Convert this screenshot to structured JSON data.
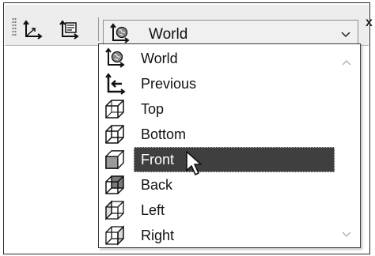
{
  "toolbar": {
    "combo": {
      "selected_value": "World",
      "icon": "world-coordinate-icon"
    },
    "buttons": [
      {
        "name": "coordinate-axes-button",
        "icon": "axes-icon"
      },
      {
        "name": "coordinate-list-button",
        "icon": "coordinate-list-icon"
      }
    ],
    "close_label": "x"
  },
  "dropdown": {
    "items": [
      {
        "label": "World",
        "icon": "world-coordinate-icon"
      },
      {
        "label": "Previous",
        "icon": "previous-coordinate-icon"
      },
      {
        "label": "Top",
        "icon": "top-view-cube-icon"
      },
      {
        "label": "Bottom",
        "icon": "bottom-view-cube-icon"
      },
      {
        "label": "Front",
        "icon": "front-view-cube-icon",
        "selected": true
      },
      {
        "label": "Back",
        "icon": "back-view-cube-icon"
      },
      {
        "label": "Left",
        "icon": "left-view-cube-icon"
      },
      {
        "label": "Right",
        "icon": "right-view-cube-icon"
      }
    ]
  },
  "colors": {
    "toolbar_bg": "#ededed",
    "highlight_bg": "#3f3f3f",
    "highlight_text": "#ffffff"
  }
}
